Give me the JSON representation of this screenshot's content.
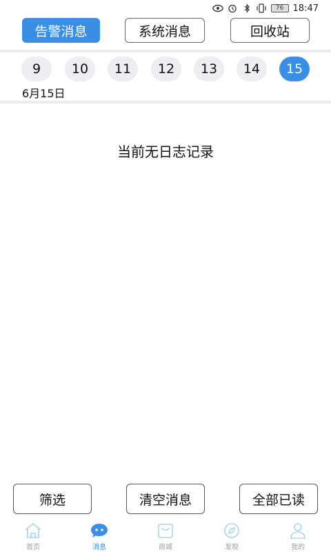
{
  "status_bar": {
    "time": "18:47",
    "battery": "76"
  },
  "tabs": [
    {
      "label": "告警消息",
      "active": true
    },
    {
      "label": "系统消息",
      "active": false
    },
    {
      "label": "回收站",
      "active": false
    }
  ],
  "dates": [
    "9",
    "10",
    "11",
    "12",
    "13",
    "14",
    "15"
  ],
  "selected_date_index": 6,
  "selected_date_label": "6月15日",
  "empty_message": "当前无日志记录",
  "actions": {
    "filter": "筛选",
    "clear": "清空消息",
    "mark_all_read": "全部已读"
  },
  "nav": [
    {
      "label": "首页",
      "icon": "home-icon",
      "active": false
    },
    {
      "label": "消息",
      "icon": "message-icon",
      "active": true
    },
    {
      "label": "商城",
      "icon": "shopping-bag-icon",
      "active": false
    },
    {
      "label": "发现",
      "icon": "compass-icon",
      "active": false
    },
    {
      "label": "我的",
      "icon": "user-icon",
      "active": false
    }
  ],
  "colors": {
    "accent": "#3a8ee6",
    "chip": "#ededf2",
    "nav_inactive": "#9aa0a6"
  }
}
